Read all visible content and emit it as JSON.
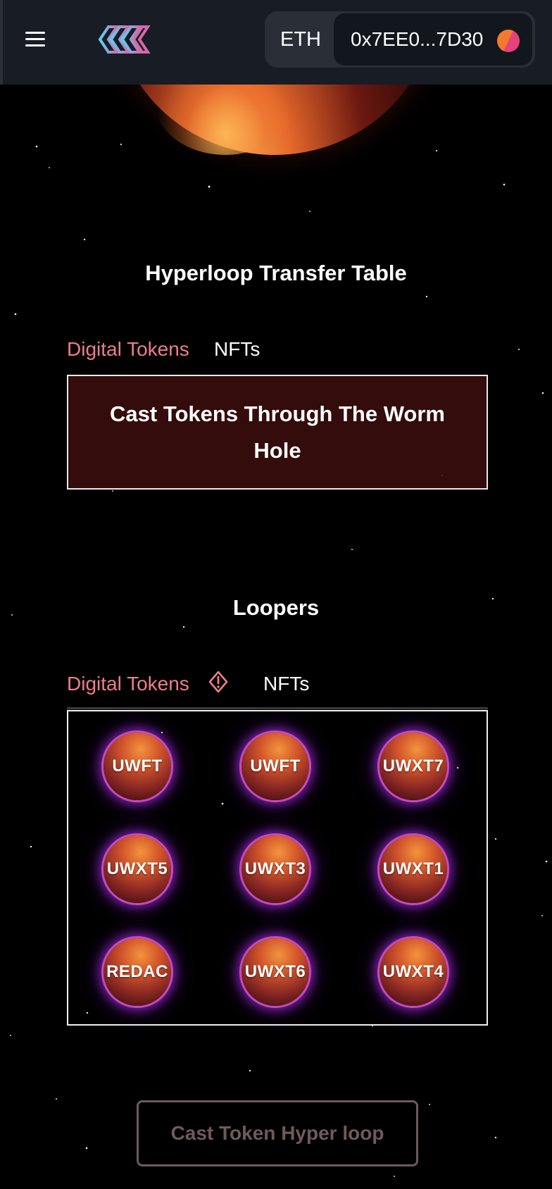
{
  "header": {
    "chain": "ETH",
    "address": "0x7EE0...7D30",
    "logo_icon": "hyperloop-logo-icon",
    "menu_icon": "hamburger-menu-icon",
    "avatar_colors": [
      "#f17a2b",
      "#e6417c"
    ]
  },
  "transfer_section": {
    "title": "Hyperloop Transfer Table",
    "tabs": [
      {
        "label": "Digital Tokens",
        "active": true
      },
      {
        "label": "NFTs",
        "active": false
      }
    ],
    "box_text": "Cast Tokens Through The Worm Hole"
  },
  "loopers_section": {
    "title": "Loopers",
    "tabs": [
      {
        "label": "Digital Tokens",
        "active": true,
        "icon": "warning-diamond-icon"
      },
      {
        "label": "NFTs",
        "active": false
      }
    ],
    "tokens": [
      "UWFT",
      "UWFT",
      "UWXT7",
      "UWXT5",
      "UWXT3",
      "UWXT1",
      "REDAC",
      "UWXT6",
      "UWXT4"
    ]
  },
  "cast_button": {
    "label": "Cast Token Hyper loop"
  },
  "colors": {
    "accent_tab": "#ec7e8a",
    "header_bg": "#181c24",
    "token_glow": "#9628d2"
  }
}
